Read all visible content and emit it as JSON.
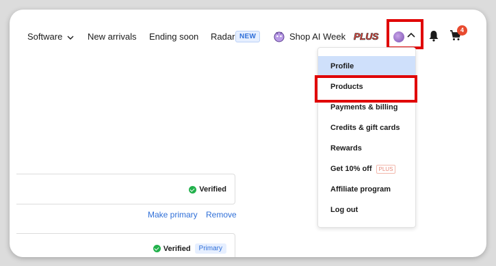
{
  "nav": {
    "software": "Software",
    "new_arrivals": "New arrivals",
    "ending_soon": "Ending soon",
    "radar": "Radar",
    "radar_badge": "NEW",
    "shop_ai_week": "Shop AI Week",
    "plus_logo": "PLUS",
    "cart_count": "4"
  },
  "menu": {
    "items": [
      {
        "label": "Profile"
      },
      {
        "label": "Products"
      },
      {
        "label": "Payments & billing"
      },
      {
        "label": "Credits & gift cards"
      },
      {
        "label": "Rewards"
      },
      {
        "label": "Get 10% off",
        "tag": "PLUS"
      },
      {
        "label": "Affiliate program"
      },
      {
        "label": "Log out"
      }
    ]
  },
  "emails": {
    "verified_label": "Verified",
    "primary_label": "Primary",
    "make_primary": "Make primary",
    "remove": "Remove"
  },
  "colors": {
    "accent_blue": "#2f6fd8",
    "highlight_red": "#e00000",
    "menu_active_bg": "#cfe0fb",
    "cart_badge": "#e84a2f"
  }
}
